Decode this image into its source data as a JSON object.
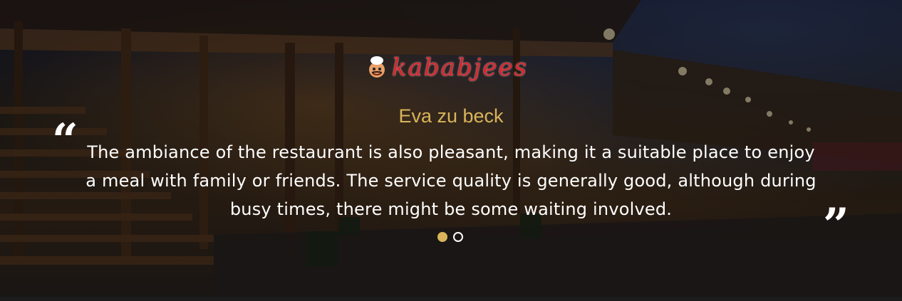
{
  "brand": {
    "logo_text": "kababjees"
  },
  "testimonial": {
    "reviewer_name": "Eva zu beck",
    "quote": "The ambiance of the restaurant is also pleasant, making it a suitable place to enjoy a meal with family or friends. The service quality is generally good, although during busy times, there might be some waiting involved.",
    "open_quote_glyph": "“",
    "close_quote_glyph": "”"
  },
  "carousel": {
    "slides": 2,
    "active_index": 0
  },
  "colors": {
    "accent": "#d9b45a",
    "logo_red": "#d8262e",
    "text": "#ffffff"
  }
}
